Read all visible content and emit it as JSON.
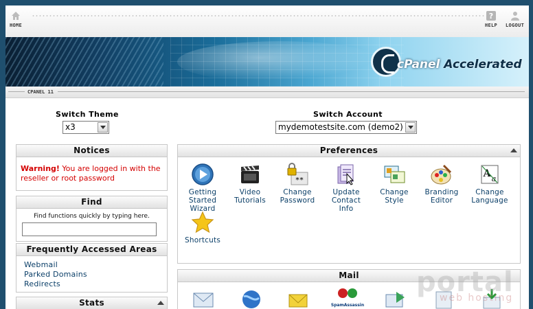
{
  "topbar": {
    "home_label": "HOME",
    "help_label": "HELP",
    "logout_label": "LOGOUT"
  },
  "banner": {
    "logo_prefix": "cPanel",
    "logo_suffix": " Accelerated"
  },
  "version": "CPANEL 11",
  "switch_theme": {
    "label": "Switch Theme",
    "value": "x3"
  },
  "switch_account": {
    "label": "Switch Account",
    "value": "mydemotestsite.com (demo2)"
  },
  "notices": {
    "title": "Notices",
    "warning_prefix": "Warning!",
    "warning_text": " You are logged in with the reseller or root password"
  },
  "find": {
    "title": "Find",
    "hint": "Find functions quickly by typing here.",
    "input_value": ""
  },
  "frequent": {
    "title": "Frequently Accessed Areas",
    "links": [
      "Webmail",
      "Parked Domains",
      "Redirects"
    ]
  },
  "stats": {
    "title": "Stats"
  },
  "preferences": {
    "title": "Preferences",
    "items": [
      {
        "label": "Getting Started Wizard",
        "icon": "getting-started-icon"
      },
      {
        "label": "Video Tutorials",
        "icon": "video-tutorials-icon"
      },
      {
        "label": "Change Password",
        "icon": "change-password-icon"
      },
      {
        "label": "Update Contact Info",
        "icon": "contact-info-icon"
      },
      {
        "label": "Change Style",
        "icon": "change-style-icon"
      },
      {
        "label": "Branding Editor",
        "icon": "branding-editor-icon"
      },
      {
        "label": "Change Language",
        "icon": "change-language-icon"
      },
      {
        "label": "Shortcuts",
        "icon": "shortcuts-icon"
      }
    ]
  },
  "mail": {
    "title": "Mail",
    "spam_label": "SpamAssassin"
  },
  "watermark": {
    "main": "portal",
    "sub": "web hosting"
  }
}
